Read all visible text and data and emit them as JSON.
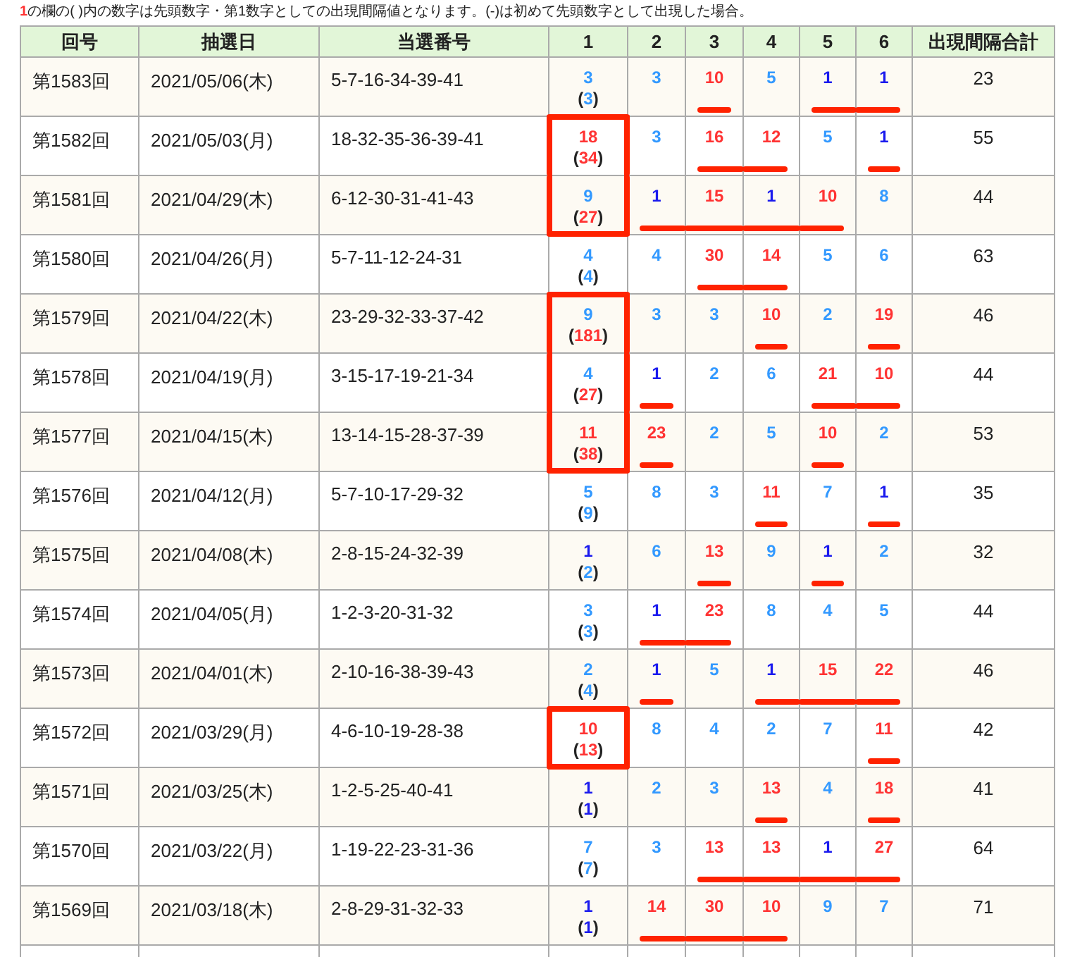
{
  "note": {
    "marker": "1",
    "text": "の欄の( )内の数字は先頭数字・第1数字としての出現間隔値となります。(-)は初めて先頭数字として出現した場合。"
  },
  "columns": [
    "回号",
    "抽選日",
    "当選番号",
    "1",
    "2",
    "3",
    "4",
    "5",
    "6",
    "出現間隔合計"
  ],
  "rows": [
    {
      "round": "第1583回",
      "date": "2021/05/06(木)",
      "numbers": "5-7-16-34-39-41",
      "boxed": false,
      "first": {
        "value": "3",
        "color": "#3399ff",
        "interval": {
          "open": "(",
          "value": "3",
          "color": "#3399ff",
          "close": ")"
        }
      },
      "cells": [
        {
          "value": "3",
          "color": "#3399ff",
          "underlined": false
        },
        {
          "value": "10",
          "color": "#ff3333",
          "underlined": true
        },
        {
          "value": "5",
          "color": "#3399ff",
          "underlined": false
        },
        {
          "value": "1",
          "color": "#1a1aee",
          "underlined": true
        },
        {
          "value": "1",
          "color": "#1a1aee",
          "underlined": true
        }
      ],
      "total": "23"
    },
    {
      "round": "第1582回",
      "date": "2021/05/03(月)",
      "numbers": "18-32-35-36-39-41",
      "boxed": true,
      "first": {
        "value": "18",
        "color": "#ff3333",
        "interval": {
          "open": "(",
          "value": "34",
          "color": "#ff3333",
          "close": ")"
        }
      },
      "cells": [
        {
          "value": "3",
          "color": "#3399ff",
          "underlined": false
        },
        {
          "value": "16",
          "color": "#ff3333",
          "underlined": true
        },
        {
          "value": "12",
          "color": "#ff3333",
          "underlined": true
        },
        {
          "value": "5",
          "color": "#3399ff",
          "underlined": false
        },
        {
          "value": "1",
          "color": "#1a1aee",
          "underlined": true
        }
      ],
      "total": "55"
    },
    {
      "round": "第1581回",
      "date": "2021/04/29(木)",
      "numbers": "6-12-30-31-41-43",
      "boxed": true,
      "first": {
        "value": "9",
        "color": "#3399ff",
        "interval": {
          "open": "(",
          "value": "27",
          "color": "#ff3333",
          "close": ")"
        }
      },
      "cells": [
        {
          "value": "1",
          "color": "#1a1aee",
          "underlined": true
        },
        {
          "value": "15",
          "color": "#ff3333",
          "underlined": true
        },
        {
          "value": "1",
          "color": "#1a1aee",
          "underlined": true
        },
        {
          "value": "10",
          "color": "#ff3333",
          "underlined": true
        },
        {
          "value": "8",
          "color": "#3399ff",
          "underlined": false
        }
      ],
      "total": "44"
    },
    {
      "round": "第1580回",
      "date": "2021/04/26(月)",
      "numbers": "5-7-11-12-24-31",
      "boxed": false,
      "first": {
        "value": "4",
        "color": "#3399ff",
        "interval": {
          "open": "(",
          "value": "4",
          "color": "#3399ff",
          "close": ")"
        }
      },
      "cells": [
        {
          "value": "4",
          "color": "#3399ff",
          "underlined": false
        },
        {
          "value": "30",
          "color": "#ff3333",
          "underlined": true
        },
        {
          "value": "14",
          "color": "#ff3333",
          "underlined": true
        },
        {
          "value": "5",
          "color": "#3399ff",
          "underlined": false
        },
        {
          "value": "6",
          "color": "#3399ff",
          "underlined": false
        }
      ],
      "total": "63"
    },
    {
      "round": "第1579回",
      "date": "2021/04/22(木)",
      "numbers": "23-29-32-33-37-42",
      "boxed": true,
      "first": {
        "value": "9",
        "color": "#3399ff",
        "interval": {
          "open": "(",
          "value": "181",
          "color": "#ff3333",
          "close": ")"
        }
      },
      "cells": [
        {
          "value": "3",
          "color": "#3399ff",
          "underlined": false
        },
        {
          "value": "3",
          "color": "#3399ff",
          "underlined": false
        },
        {
          "value": "10",
          "color": "#ff3333",
          "underlined": true
        },
        {
          "value": "2",
          "color": "#3399ff",
          "underlined": false
        },
        {
          "value": "19",
          "color": "#ff3333",
          "underlined": true
        }
      ],
      "total": "46"
    },
    {
      "round": "第1578回",
      "date": "2021/04/19(月)",
      "numbers": "3-15-17-19-21-34",
      "boxed": true,
      "first": {
        "value": "4",
        "color": "#3399ff",
        "interval": {
          "open": "(",
          "value": "27",
          "color": "#ff3333",
          "close": ")"
        }
      },
      "cells": [
        {
          "value": "1",
          "color": "#1a1aee",
          "underlined": true
        },
        {
          "value": "2",
          "color": "#3399ff",
          "underlined": false
        },
        {
          "value": "6",
          "color": "#3399ff",
          "underlined": false
        },
        {
          "value": "21",
          "color": "#ff3333",
          "underlined": true
        },
        {
          "value": "10",
          "color": "#ff3333",
          "underlined": true
        }
      ],
      "total": "44"
    },
    {
      "round": "第1577回",
      "date": "2021/04/15(木)",
      "numbers": "13-14-15-28-37-39",
      "boxed": true,
      "first": {
        "value": "11",
        "color": "#ff3333",
        "interval": {
          "open": "(",
          "value": "38",
          "color": "#ff3333",
          "close": ")"
        }
      },
      "cells": [
        {
          "value": "23",
          "color": "#ff3333",
          "underlined": true
        },
        {
          "value": "2",
          "color": "#3399ff",
          "underlined": false
        },
        {
          "value": "5",
          "color": "#3399ff",
          "underlined": false
        },
        {
          "value": "10",
          "color": "#ff3333",
          "underlined": true
        },
        {
          "value": "2",
          "color": "#3399ff",
          "underlined": false
        }
      ],
      "total": "53"
    },
    {
      "round": "第1576回",
      "date": "2021/04/12(月)",
      "numbers": "5-7-10-17-29-32",
      "boxed": false,
      "first": {
        "value": "5",
        "color": "#3399ff",
        "interval": {
          "open": "(",
          "value": "9",
          "color": "#3399ff",
          "close": ")"
        }
      },
      "cells": [
        {
          "value": "8",
          "color": "#3399ff",
          "underlined": false
        },
        {
          "value": "3",
          "color": "#3399ff",
          "underlined": false
        },
        {
          "value": "11",
          "color": "#ff3333",
          "underlined": true
        },
        {
          "value": "7",
          "color": "#3399ff",
          "underlined": false
        },
        {
          "value": "1",
          "color": "#1a1aee",
          "underlined": true
        }
      ],
      "total": "35"
    },
    {
      "round": "第1575回",
      "date": "2021/04/08(木)",
      "numbers": "2-8-15-24-32-39",
      "boxed": false,
      "first": {
        "value": "1",
        "color": "#1a1aee",
        "interval": {
          "open": "(",
          "value": "2",
          "color": "#3399ff",
          "close": ")"
        }
      },
      "cells": [
        {
          "value": "6",
          "color": "#3399ff",
          "underlined": false
        },
        {
          "value": "13",
          "color": "#ff3333",
          "underlined": true
        },
        {
          "value": "9",
          "color": "#3399ff",
          "underlined": false
        },
        {
          "value": "1",
          "color": "#1a1aee",
          "underlined": true
        },
        {
          "value": "2",
          "color": "#3399ff",
          "underlined": false
        }
      ],
      "total": "32"
    },
    {
      "round": "第1574回",
      "date": "2021/04/05(月)",
      "numbers": "1-2-3-20-31-32",
      "boxed": false,
      "first": {
        "value": "3",
        "color": "#3399ff",
        "interval": {
          "open": "(",
          "value": "3",
          "color": "#3399ff",
          "close": ")"
        }
      },
      "cells": [
        {
          "value": "1",
          "color": "#1a1aee",
          "underlined": true
        },
        {
          "value": "23",
          "color": "#ff3333",
          "underlined": true
        },
        {
          "value": "8",
          "color": "#3399ff",
          "underlined": false
        },
        {
          "value": "4",
          "color": "#3399ff",
          "underlined": false
        },
        {
          "value": "5",
          "color": "#3399ff",
          "underlined": false
        }
      ],
      "total": "44"
    },
    {
      "round": "第1573回",
      "date": "2021/04/01(木)",
      "numbers": "2-10-16-38-39-43",
      "boxed": false,
      "first": {
        "value": "2",
        "color": "#3399ff",
        "interval": {
          "open": "(",
          "value": "4",
          "color": "#3399ff",
          "close": ")"
        }
      },
      "cells": [
        {
          "value": "1",
          "color": "#1a1aee",
          "underlined": true
        },
        {
          "value": "5",
          "color": "#3399ff",
          "underlined": false
        },
        {
          "value": "1",
          "color": "#1a1aee",
          "underlined": true
        },
        {
          "value": "15",
          "color": "#ff3333",
          "underlined": true
        },
        {
          "value": "22",
          "color": "#ff3333",
          "underlined": true
        }
      ],
      "total": "46"
    },
    {
      "round": "第1572回",
      "date": "2021/03/29(月)",
      "numbers": "4-6-10-19-28-38",
      "boxed": true,
      "first": {
        "value": "10",
        "color": "#ff3333",
        "interval": {
          "open": "(",
          "value": "13",
          "color": "#ff3333",
          "close": ")"
        }
      },
      "cells": [
        {
          "value": "8",
          "color": "#3399ff",
          "underlined": false
        },
        {
          "value": "4",
          "color": "#3399ff",
          "underlined": false
        },
        {
          "value": "2",
          "color": "#3399ff",
          "underlined": false
        },
        {
          "value": "7",
          "color": "#3399ff",
          "underlined": false
        },
        {
          "value": "11",
          "color": "#ff3333",
          "underlined": true
        }
      ],
      "total": "42"
    },
    {
      "round": "第1571回",
      "date": "2021/03/25(木)",
      "numbers": "1-2-5-25-40-41",
      "boxed": false,
      "first": {
        "value": "1",
        "color": "#1a1aee",
        "interval": {
          "open": "(",
          "value": "1",
          "color": "#1a1aee",
          "close": ")"
        }
      },
      "cells": [
        {
          "value": "2",
          "color": "#3399ff",
          "underlined": false
        },
        {
          "value": "3",
          "color": "#3399ff",
          "underlined": false
        },
        {
          "value": "13",
          "color": "#ff3333",
          "underlined": true
        },
        {
          "value": "4",
          "color": "#3399ff",
          "underlined": false
        },
        {
          "value": "18",
          "color": "#ff3333",
          "underlined": true
        }
      ],
      "total": "41"
    },
    {
      "round": "第1570回",
      "date": "2021/03/22(月)",
      "numbers": "1-19-22-23-31-36",
      "boxed": false,
      "first": {
        "value": "7",
        "color": "#3399ff",
        "interval": {
          "open": "(",
          "value": "7",
          "color": "#3399ff",
          "close": ")"
        }
      },
      "cells": [
        {
          "value": "3",
          "color": "#3399ff",
          "underlined": false
        },
        {
          "value": "13",
          "color": "#ff3333",
          "underlined": true
        },
        {
          "value": "13",
          "color": "#ff3333",
          "underlined": true
        },
        {
          "value": "1",
          "color": "#1a1aee",
          "underlined": true
        },
        {
          "value": "27",
          "color": "#ff3333",
          "underlined": true
        }
      ],
      "total": "64"
    },
    {
      "round": "第1569回",
      "date": "2021/03/18(木)",
      "numbers": "2-8-29-31-32-33",
      "boxed": false,
      "first": {
        "value": "1",
        "color": "#1a1aee",
        "interval": {
          "open": "(",
          "value": "1",
          "color": "#1a1aee",
          "close": ")"
        }
      },
      "cells": [
        {
          "value": "14",
          "color": "#ff3333",
          "underlined": true
        },
        {
          "value": "30",
          "color": "#ff3333",
          "underlined": true
        },
        {
          "value": "10",
          "color": "#ff3333",
          "underlined": true
        },
        {
          "value": "9",
          "color": "#3399ff",
          "underlined": false
        },
        {
          "value": "7",
          "color": "#3399ff",
          "underlined": false
        }
      ],
      "total": "71"
    }
  ]
}
